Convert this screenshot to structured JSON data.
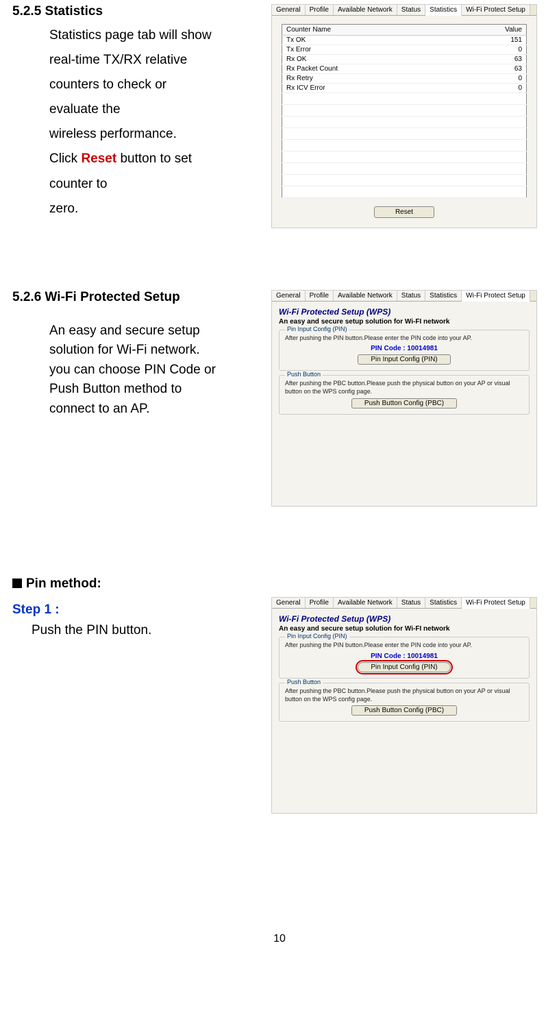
{
  "section1": {
    "heading": "5.2.5 Statistics",
    "line1": "Statistics page tab will show",
    "line2": "real-time TX/RX relative",
    "line3": "counters to check or",
    "line4": "evaluate the",
    "line5": "wireless performance.",
    "line6a": "Click ",
    "line6b": "Reset",
    "line6c": " button to set",
    "line7": "counter to",
    "line8": "zero."
  },
  "stats_panel": {
    "tabs": [
      "General",
      "Profile",
      "Available Network",
      "Status",
      "Statistics",
      "Wi-Fi Protect Setup"
    ],
    "active_tab": "Statistics",
    "col1": "Counter Name",
    "col2": "Value",
    "rows": [
      {
        "name": "Tx OK",
        "value": "151"
      },
      {
        "name": "Tx Error",
        "value": "0"
      },
      {
        "name": "Rx OK",
        "value": "63"
      },
      {
        "name": "Rx Packet Count",
        "value": "63"
      },
      {
        "name": "Rx Retry",
        "value": "0"
      },
      {
        "name": "Rx ICV Error",
        "value": "0"
      }
    ],
    "reset_label": "Reset"
  },
  "section2": {
    "heading": "5.2.6 Wi-Fi Protected Setup",
    "line1": "An easy and secure setup",
    "line2": "solution for Wi-Fi network.",
    "line3": "you can choose PIN Code or",
    "line4": "Push Button method to",
    "line5": "connect to an AP."
  },
  "wps_panel": {
    "tabs": [
      "General",
      "Profile",
      "Available Network",
      "Status",
      "Statistics",
      "Wi-Fi Protect Setup"
    ],
    "active_tab": "Wi-Fi Protect Setup",
    "title": "Wi-Fi Protected Setup (WPS)",
    "subtitle": "An easy and secure setup solution for Wi-FI network",
    "pin_group_title": "Pin Input Config (PIN)",
    "pin_group_text": "After pushing the PIN button.Please enter the PIN code into your AP.",
    "pin_code_label": "PIN Code :  10014981",
    "pin_btn": "Pin Input Config (PIN)",
    "push_group_title": "Push Button",
    "push_group_text": "After pushing the PBC button.Please push the physical button on your AP or visual button on the WPS config page.",
    "push_btn": "Push Button Config (PBC)"
  },
  "section3": {
    "pin_method_label": "Pin method:",
    "step_label": "Step 1 :",
    "push_text": "Push the PIN button."
  },
  "page_number": "10"
}
